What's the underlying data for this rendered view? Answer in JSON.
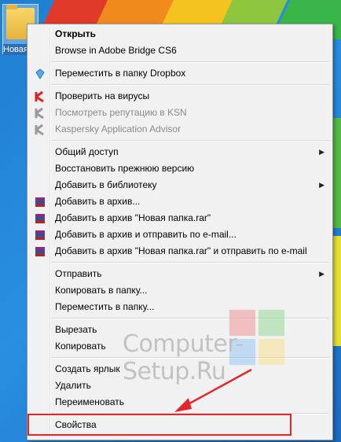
{
  "desktop": {
    "icon_label": "Новая папка"
  },
  "menu": {
    "items": [
      {
        "label": "Открыть",
        "bold": true
      },
      {
        "label": "Browse in Adobe Bridge CS6"
      },
      {
        "label": "Переместить в папку Dropbox",
        "icon": "dropbox-icon"
      },
      {
        "label": "Проверить на вирусы",
        "icon": "kaspersky-icon"
      },
      {
        "label": "Посмотреть репутацию в KSN",
        "icon": "kaspersky-icon",
        "disabled": true
      },
      {
        "label": "Kaspersky Application Advisor",
        "icon": "kaspersky-icon",
        "disabled": true
      },
      {
        "label": "Общий доступ",
        "submenu": true
      },
      {
        "label": "Восстановить прежнюю версию"
      },
      {
        "label": "Добавить в библиотеку",
        "submenu": true
      },
      {
        "label": "Добавить в архив...",
        "icon": "winrar-icon"
      },
      {
        "label": "Добавить в архив \"Новая папка.rar\"",
        "icon": "winrar-icon"
      },
      {
        "label": "Добавить в архив и отправить по e-mail...",
        "icon": "winrar-icon"
      },
      {
        "label": "Добавить в архив \"Новая папка.rar\" и отправить по e-mail",
        "icon": "winrar-icon"
      },
      {
        "label": "Отправить",
        "submenu": true
      },
      {
        "label": "Копировать в папку..."
      },
      {
        "label": "Переместить в папку..."
      },
      {
        "label": "Вырезать"
      },
      {
        "label": "Копировать"
      },
      {
        "label": "Создать ярлык"
      },
      {
        "label": "Удалить"
      },
      {
        "label": "Переименовать"
      },
      {
        "label": "Свойства"
      }
    ]
  },
  "watermark": {
    "text": "Computer-Setup.Ru"
  },
  "colors": {
    "highlight": "#e3262c",
    "menu_bg": "#f1f1f1",
    "desktop": "#1f7ed0"
  }
}
